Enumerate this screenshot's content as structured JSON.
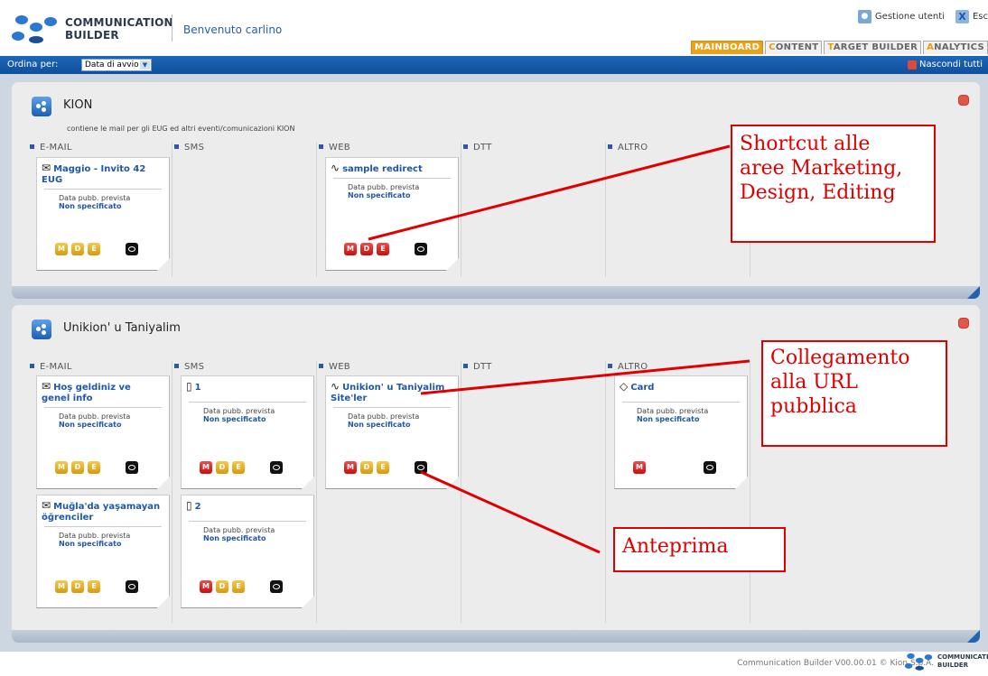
{
  "header": {
    "logo_line1": "COMMUNICATION",
    "logo_line2": "BUILDER",
    "welcome": "Benvenuto carlino",
    "user_mgmt": "Gestione utenti",
    "exit": "Esc"
  },
  "tabs": [
    {
      "first": "M",
      "rest": "AINBOARD"
    },
    {
      "first": "C",
      "rest": "ONTENT"
    },
    {
      "first": "T",
      "rest": "ARGET BUILDER"
    },
    {
      "first": "A",
      "rest": "NALYTICS"
    }
  ],
  "toolbar": {
    "order_label": "Ordina per:",
    "order_value": "Data di avvio",
    "hide_all": "Nascondi tutti"
  },
  "columns": [
    "E-MAIL",
    "SMS",
    "WEB",
    "DTT",
    "ALTRO"
  ],
  "meta_label": "Data pubb. prevista",
  "meta_value": "Non specificato",
  "panel1": {
    "title": "KION",
    "description": "contiene le mail per gli EUG ed altri eventi/comunicazioni KION",
    "cards": [
      {
        "title": "Maggio - Invito 42 EUG"
      },
      {
        "title": "sample redirect"
      }
    ]
  },
  "panel2": {
    "title": "Unikion' u Taniyalim",
    "cards": [
      {
        "title": "Hoş geldiniz ve genel info"
      },
      {
        "title": "1"
      },
      {
        "title": "Unikion' u Taniyalim Site'ler"
      },
      {
        "title": "Card"
      },
      {
        "title": "Muğla'da yaşamayan öğrenciler"
      },
      {
        "title": "2"
      }
    ]
  },
  "buttons": {
    "m": "M",
    "d": "D",
    "e": "E"
  },
  "annotations": {
    "shortcut": [
      "Shortcut alle",
      "aree Marketing,",
      "Design, Editing"
    ],
    "url": [
      "Collegamento",
      "alla URL",
      "pubblica"
    ],
    "preview": "Anteprima"
  },
  "footer": {
    "text": "Communication Builder V00.00.01 © Kion S.p.A.",
    "logo_line1": "COMMUNICATION",
    "logo_line2": "BUILDER"
  }
}
